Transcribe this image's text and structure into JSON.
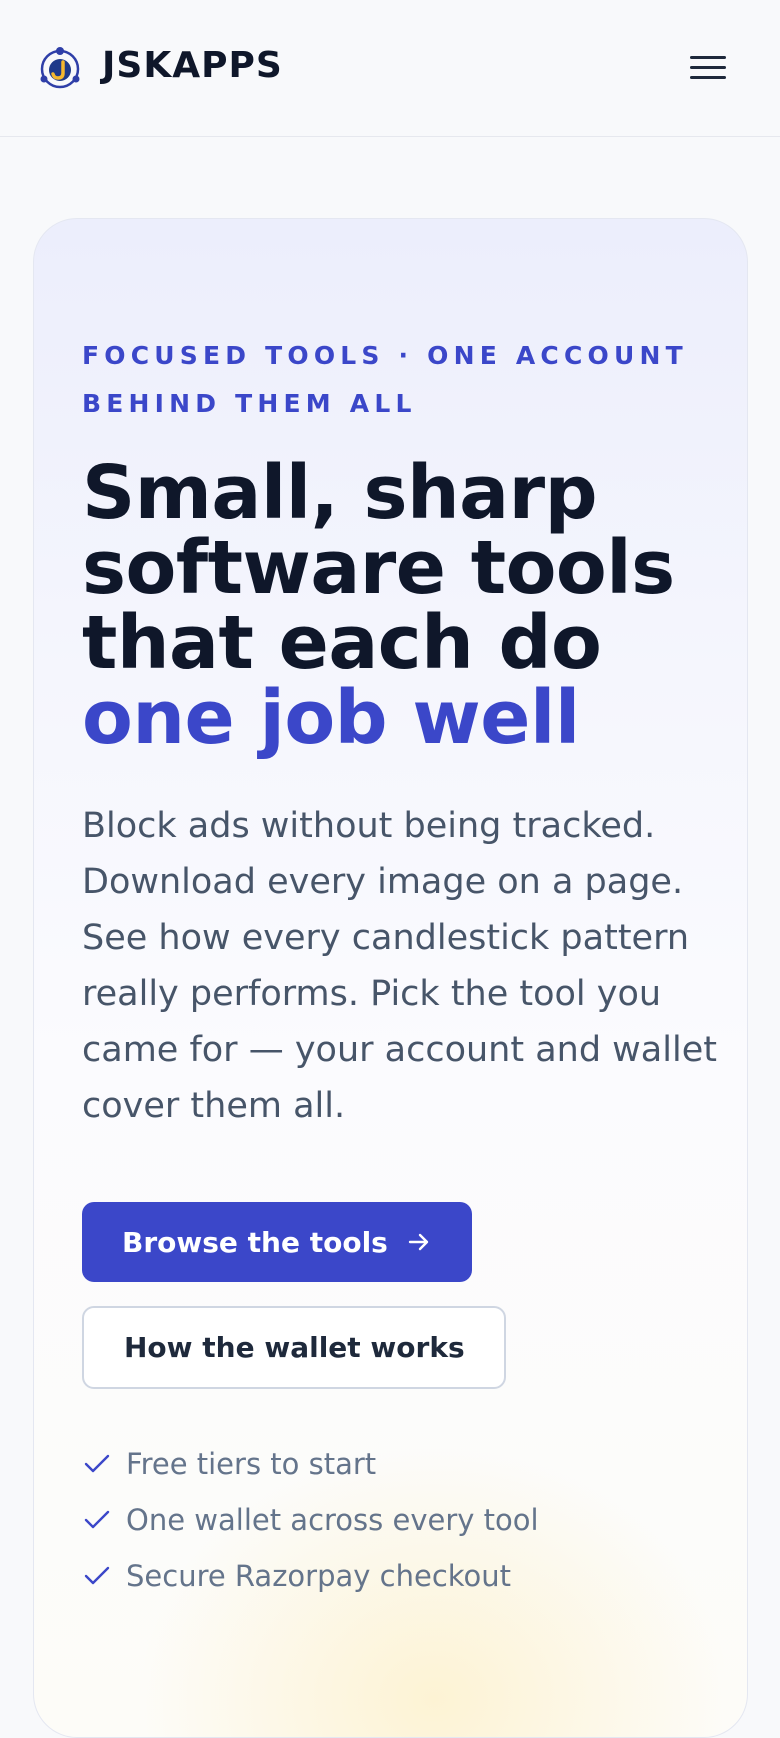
{
  "header": {
    "brand": "JSKAPPS",
    "logo_icon": "jskapps-logo-icon",
    "menu_icon": "hamburger-menu-icon"
  },
  "hero": {
    "eyebrow": "FOCUSED TOOLS · ONE ACCOUNT BEHIND THEM ALL",
    "headline": "Small, sharp software tools that each do",
    "headline_accent": "one job well",
    "lede": "Block ads without being tracked. Download every image on a page. See how every candlestick pattern really performs. Pick the tool you came for — your account and wallet cover them all.",
    "primary_button": "Browse the tools",
    "primary_button_icon": "arrow-right-icon",
    "secondary_button": "How the wallet works",
    "features": [
      "Free tiers to start",
      "One wallet across every tool",
      "Secure Razorpay checkout"
    ],
    "feature_icon": "check-icon"
  },
  "colors": {
    "accent": "#3b47c9",
    "text_dark": "#0f172a",
    "text_body": "#475569",
    "text_muted": "#64748b",
    "page_bg": "#f8f9fb"
  }
}
